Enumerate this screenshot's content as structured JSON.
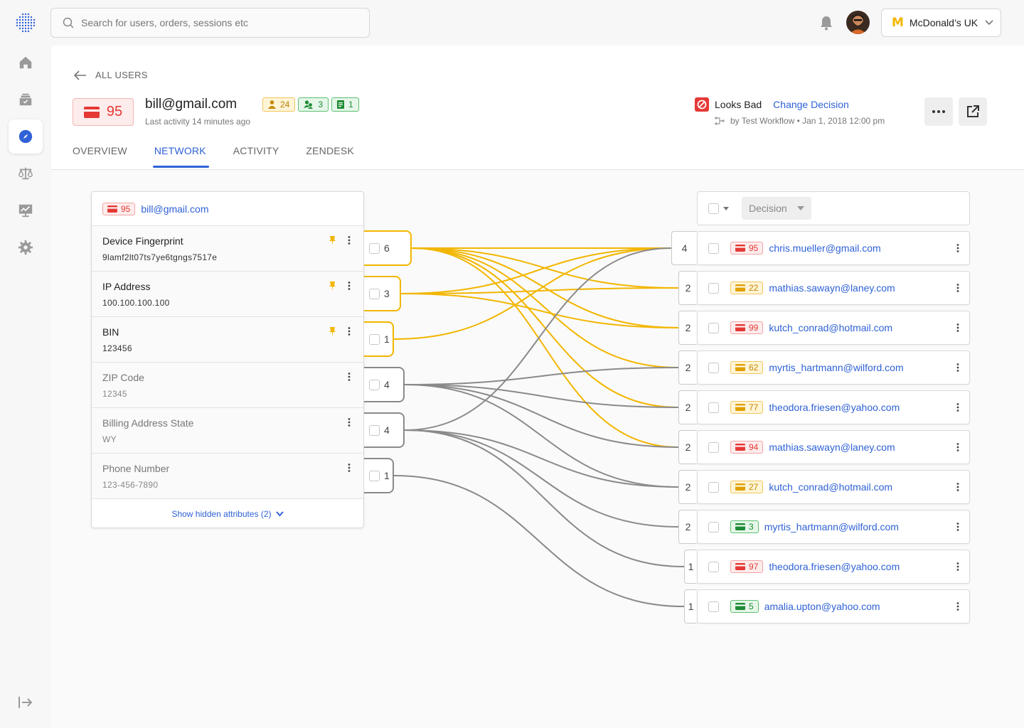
{
  "search": {
    "placeholder": "Search for users, orders, sessions etc"
  },
  "merchant": {
    "name": "McDonald’s UK",
    "logo_glyph": "M"
  },
  "rail": {
    "items": [
      {
        "name": "home-icon",
        "active": false
      },
      {
        "name": "inbox-icon",
        "active": false
      },
      {
        "name": "explore-icon",
        "active": true
      },
      {
        "name": "scales-icon",
        "active": false
      },
      {
        "name": "analytics-icon",
        "active": false
      },
      {
        "name": "settings-icon",
        "active": false
      }
    ]
  },
  "header": {
    "back_label": "ALL USERS",
    "score": "95",
    "email": "bill@gmail.com",
    "last_activity": "Last activity 14 minutes ago",
    "pills": [
      {
        "icon": "person-icon",
        "value": "24",
        "color": "yellow"
      },
      {
        "icon": "people-icon",
        "value": "3",
        "color": "green"
      },
      {
        "icon": "document-icon",
        "value": "1",
        "color": "green"
      }
    ],
    "decision": {
      "status": "Looks Bad",
      "change_label": "Change Decision",
      "meta": "by Test Workflow • Jan 1, 2018 12:00 pm"
    },
    "tabs": [
      {
        "label": "OVERVIEW",
        "active": false
      },
      {
        "label": "NETWORK",
        "active": true
      },
      {
        "label": "ACTIVITY",
        "active": false
      },
      {
        "label": "ZENDESK",
        "active": false
      }
    ]
  },
  "attributes_card": {
    "score": "95",
    "email": "bill@gmail.com",
    "rows": [
      {
        "label": "Device Fingerprint",
        "value": "9lamf2lt07ts7ye6tgngs7517e",
        "pinned": true,
        "muted": false,
        "count": "6",
        "color": "yellow"
      },
      {
        "label": "IP Address",
        "value": "100.100.100.100",
        "pinned": true,
        "muted": false,
        "count": "3",
        "color": "yellow"
      },
      {
        "label": "BIN",
        "value": "123456",
        "pinned": true,
        "muted": false,
        "count": "1",
        "color": "yellow"
      },
      {
        "label": "ZIP Code",
        "value": "12345",
        "pinned": false,
        "muted": true,
        "count": "4",
        "color": "gray"
      },
      {
        "label": "Billing Address State",
        "value": "WY",
        "pinned": false,
        "muted": true,
        "count": "4",
        "color": "gray"
      },
      {
        "label": "Phone Number",
        "value": "123-456-7890",
        "pinned": false,
        "muted": true,
        "count": "1",
        "color": "gray"
      }
    ],
    "show_hidden": "Show hidden attributes (2)"
  },
  "users_panel": {
    "decision_placeholder": "Decision",
    "users": [
      {
        "connections": "4",
        "score": "95",
        "score_color": "red",
        "email": "chris.mueller@gmail.com"
      },
      {
        "connections": "2",
        "score": "22",
        "score_color": "yellow",
        "email": "mathias.sawayn@laney.com"
      },
      {
        "connections": "2",
        "score": "99",
        "score_color": "red",
        "email": "kutch_conrad@hotmail.com"
      },
      {
        "connections": "2",
        "score": "62",
        "score_color": "yellow",
        "email": "myrtis_hartmann@wilford.com"
      },
      {
        "connections": "2",
        "score": "77",
        "score_color": "yellow",
        "email": "theodora.friesen@yahoo.com"
      },
      {
        "connections": "2",
        "score": "94",
        "score_color": "red",
        "email": "mathias.sawayn@laney.com"
      },
      {
        "connections": "2",
        "score": "27",
        "score_color": "yellow",
        "email": "kutch_conrad@hotmail.com"
      },
      {
        "connections": "2",
        "score": "3",
        "score_color": "green",
        "email": "myrtis_hartmann@wilford.com"
      },
      {
        "connections": "1",
        "score": "97",
        "score_color": "red",
        "email": "theodora.friesen@yahoo.com"
      },
      {
        "connections": "1",
        "score": "5",
        "score_color": "green",
        "email": "amalia.upton@yahoo.com"
      }
    ]
  },
  "links": {
    "colors": {
      "yellow": "#f2b600",
      "gray": "#8a8a8a"
    },
    "edges": [
      {
        "attr": 0,
        "user": 0,
        "color": "yellow"
      },
      {
        "attr": 0,
        "user": 2,
        "color": "yellow"
      },
      {
        "attr": 0,
        "user": 3,
        "color": "yellow"
      },
      {
        "attr": 0,
        "user": 4,
        "color": "yellow"
      },
      {
        "attr": 0,
        "user": 5,
        "color": "yellow"
      },
      {
        "attr": 0,
        "user": 1,
        "color": "yellow"
      },
      {
        "attr": 1,
        "user": 0,
        "color": "yellow"
      },
      {
        "attr": 1,
        "user": 1,
        "color": "yellow"
      },
      {
        "attr": 1,
        "user": 2,
        "color": "yellow"
      },
      {
        "attr": 2,
        "user": 0,
        "color": "yellow"
      },
      {
        "attr": 3,
        "user": 3,
        "color": "gray"
      },
      {
        "attr": 3,
        "user": 4,
        "color": "gray"
      },
      {
        "attr": 3,
        "user": 5,
        "color": "gray"
      },
      {
        "attr": 3,
        "user": 6,
        "color": "gray"
      },
      {
        "attr": 4,
        "user": 0,
        "color": "gray"
      },
      {
        "attr": 4,
        "user": 6,
        "color": "gray"
      },
      {
        "attr": 4,
        "user": 7,
        "color": "gray"
      },
      {
        "attr": 4,
        "user": 8,
        "color": "gray"
      },
      {
        "attr": 5,
        "user": 9,
        "color": "gray"
      }
    ]
  }
}
